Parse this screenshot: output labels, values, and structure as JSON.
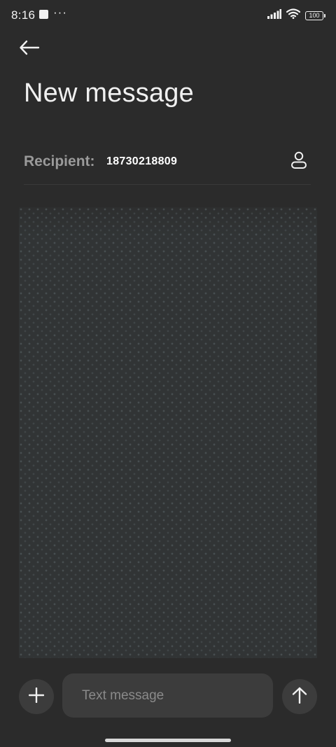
{
  "status_bar": {
    "time": "8:16",
    "dots": "···",
    "battery": "100",
    "icons": [
      "notification-square-icon",
      "more-dots-icon",
      "signal-icon",
      "wifi-icon",
      "battery-icon"
    ]
  },
  "header": {
    "back_icon": "back-arrow-icon",
    "title": "New message"
  },
  "recipient": {
    "label": "Recipient:",
    "value": "18730218809",
    "contact_icon": "contact-person-icon"
  },
  "composer": {
    "attach_icon": "plus-icon",
    "placeholder": "Text message",
    "value": "",
    "send_icon": "send-arrow-up-icon"
  },
  "colors": {
    "background": "#2b2b2b",
    "surface": "#3c3c3c",
    "conversation_bg": "#313435",
    "label_gray": "#9a9a9a",
    "text": "#ffffff"
  }
}
